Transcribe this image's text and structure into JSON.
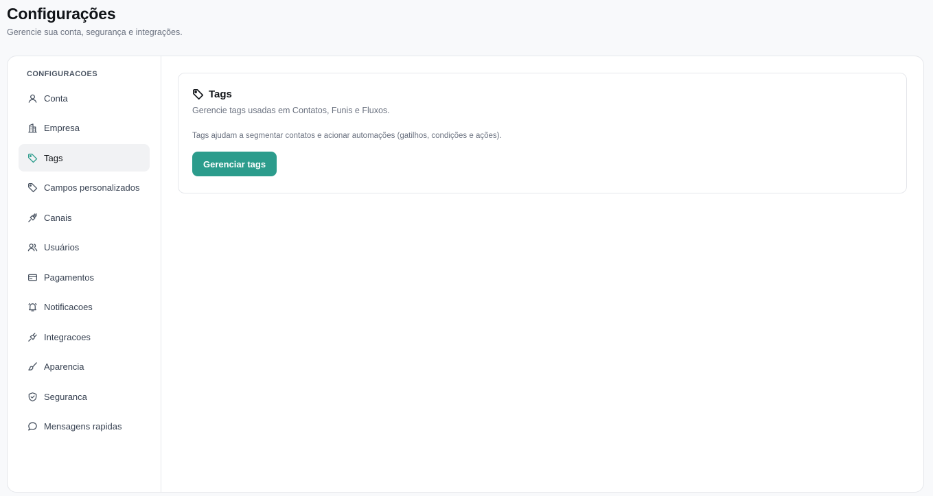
{
  "header": {
    "title": "Configurações",
    "subtitle": "Gerencie sua conta, segurança e integrações."
  },
  "sidebar": {
    "section_title": "CONFIGURACOES",
    "active_item": "Tags",
    "items": [
      {
        "label": "Conta",
        "icon": "user-icon"
      },
      {
        "label": "Empresa",
        "icon": "building-icon"
      },
      {
        "label": "Tags",
        "icon": "tag-icon"
      },
      {
        "label": "Campos personalizados",
        "icon": "tag-icon"
      },
      {
        "label": "Canais",
        "icon": "plug-icon"
      },
      {
        "label": "Usuários",
        "icon": "users-icon"
      },
      {
        "label": "Pagamentos",
        "icon": "credit-card-icon"
      },
      {
        "label": "Notificacoes",
        "icon": "bell-icon"
      },
      {
        "label": "Integracoes",
        "icon": "plug-icon"
      },
      {
        "label": "Aparencia",
        "icon": "brush-icon"
      },
      {
        "label": "Seguranca",
        "icon": "shield-icon"
      },
      {
        "label": "Mensagens rapidas",
        "icon": "message-icon"
      }
    ]
  },
  "card": {
    "title": "Tags",
    "icon": "tag-icon",
    "description": "Gerencie tags usadas em Contatos, Funis e Fluxos.",
    "help_text": "Tags ajudam a segmentar contatos e acionar automações (gatilhos, condições e ações).",
    "button_label": "Gerenciar tags"
  },
  "colors": {
    "accent": "#2c9c8c",
    "active_bg": "#f1f2f4",
    "page_bg": "#f8f9fb",
    "border": "#e5e7eb"
  }
}
